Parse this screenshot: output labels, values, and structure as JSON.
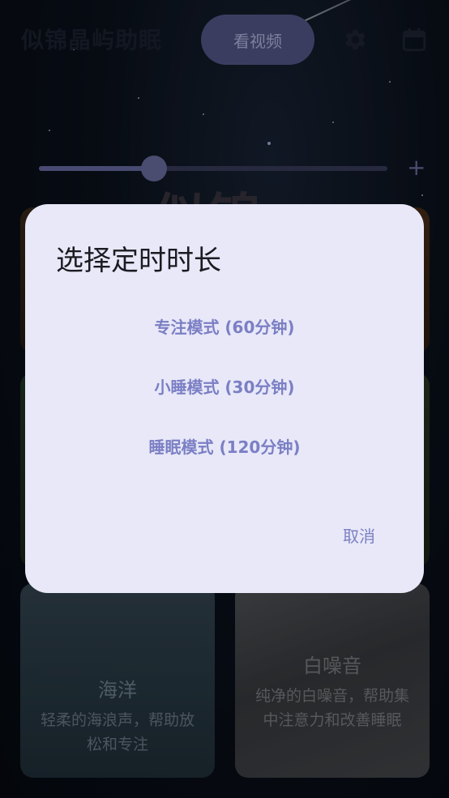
{
  "app": {
    "title": "似锦晶屿助眠",
    "video_button_label": "看视频",
    "settings_icon": "gear-icon",
    "calendar_icon": "calendar-icon"
  },
  "volume": {
    "level": 0.33,
    "plus_label": "+"
  },
  "background_title": "似锦",
  "cards": {
    "ocean": {
      "title": "海洋",
      "description": "轻柔的海浪声，帮助放松和专注"
    },
    "white_noise": {
      "title": "白噪音",
      "description": "纯净的白噪音，帮助集中注意力和改善睡眠"
    }
  },
  "dialog": {
    "title": "选择定时时长",
    "options": [
      "专注模式 (60分钟)",
      "小睡模式 (30分钟)",
      "睡眠模式 (120分钟)"
    ],
    "cancel_label": "取消"
  },
  "colors": {
    "accent": "#7b7fc4",
    "dialog_bg": "#e8e8f8",
    "button_bg": "#585a8e"
  }
}
